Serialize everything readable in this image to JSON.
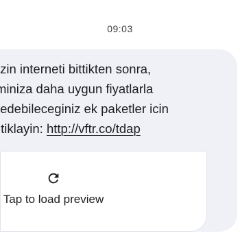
{
  "timestamp": "09:03",
  "message": {
    "lines": [
      "rifenizin interneti bittikten sonra,",
      "ılaniminiza daha uygun fiyatlarla",
      "vam edebileceginiz ek paketler icin",
      "men tiklayin: "
    ],
    "link_text": "http://vftr.co/tdap"
  },
  "preview": {
    "icon": "refresh-icon",
    "label": "Tap to load preview"
  },
  "colors": {
    "bubble_background": "#f0f1f6",
    "text": "#1d1d1f",
    "card_background": "#ffffff"
  }
}
